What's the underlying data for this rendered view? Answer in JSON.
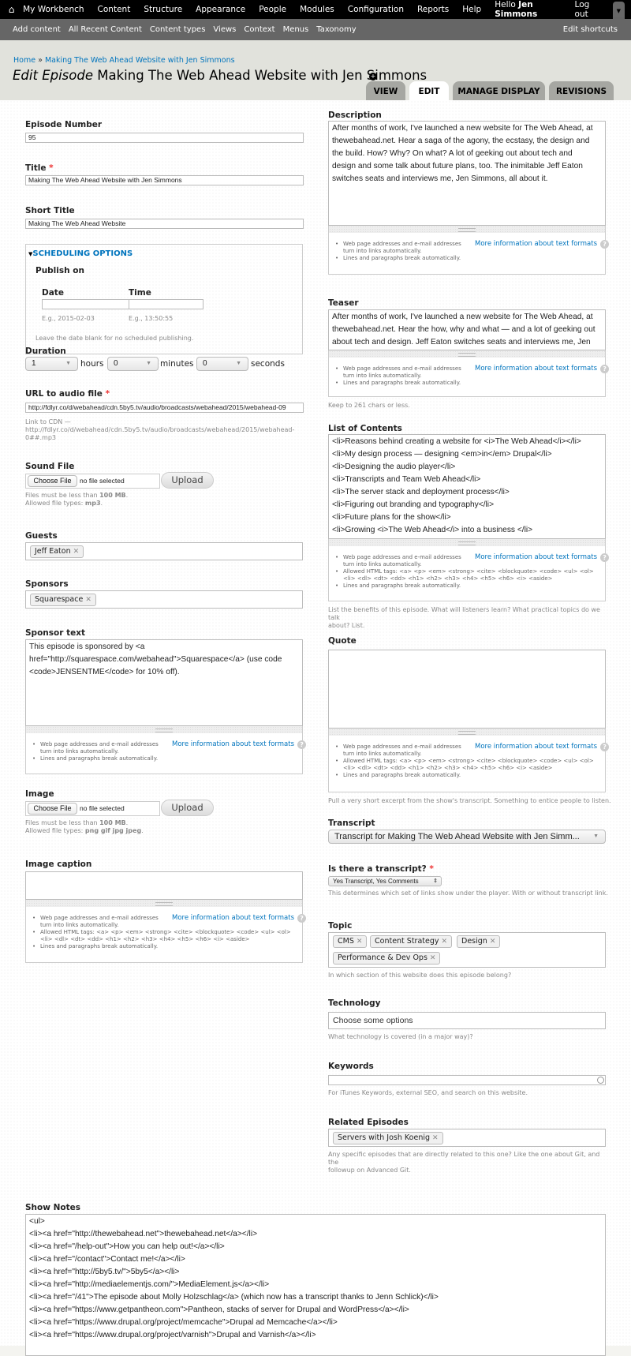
{
  "toolbar": {
    "home_icon": "home-icon",
    "menu": [
      "My Workbench",
      "Content",
      "Structure",
      "Appearance",
      "People",
      "Modules",
      "Configuration",
      "Reports",
      "Help"
    ],
    "hello_prefix": "Hello ",
    "user_name": "Jen Simmons",
    "logout": "Log out",
    "drawer_icon": "chevron-down-icon",
    "shortcuts": [
      "Add content",
      "All Recent Content",
      "Content types",
      "Views",
      "Context",
      "Menus",
      "Taxonomy"
    ],
    "edit_shortcuts": "Edit shortcuts"
  },
  "header": {
    "breadcrumb": {
      "home": "Home",
      "separator": "»",
      "current": "Making The Web Ahead Website with Jen Simmons"
    },
    "title_prefix": "Edit Episode",
    "title": "Making The Web Ahead Website with Jen Simmons",
    "add_shortcut_icon": "plus-circle-icon",
    "tabs": [
      {
        "label": "VIEW",
        "active": false
      },
      {
        "label": "EDIT",
        "active": true
      },
      {
        "label": "MANAGE DISPLAY",
        "active": false
      },
      {
        "label": "REVISIONS",
        "active": false
      }
    ]
  },
  "colors": {
    "link": "#0074bd",
    "required": "#e33333",
    "toolbar": "#000000",
    "shortcuts": "#666666"
  },
  "filter_tips": {
    "urls": "Web page addresses and e-mail addresses turn into links automatically.",
    "allowed_html": "Allowed HTML tags: <a> <p> <em> <strong> <cite> <blockquote> <code> <ul> <ol> <li> <dl> <dt> <dd> <h1> <h2> <h3> <h4> <h5> <h6> <i> <aside>",
    "linebreaks": "Lines and paragraphs break automatically.",
    "more_info": "More information about text formats",
    "help_icon": "question-icon"
  },
  "left": {
    "episode_number": {
      "label": "Episode Number",
      "value": "95"
    },
    "title": {
      "label": "Title",
      "required": "*",
      "value": "Making The Web Ahead Website with Jen Simmons"
    },
    "short_title": {
      "label": "Short Title",
      "value": "Making The Web Ahead Website"
    },
    "scheduling": {
      "legend": "SCHEDULING OPTIONS",
      "collapse_icon": "triangle-down-icon",
      "publish_on": "Publish on",
      "date_label": "Date",
      "time_label": "Time",
      "date_value": "",
      "time_value": "",
      "date_example": "E.g., 2015-02-03",
      "time_example": "E.g., 13:50:55",
      "description": "Leave the date blank for no scheduled publishing."
    },
    "duration": {
      "label": "Duration",
      "hours": "1",
      "hours_unit": "hours",
      "minutes": "0",
      "minutes_unit": "minutes",
      "seconds": "0",
      "seconds_unit": "seconds"
    },
    "audio_url": {
      "label": "URL to audio file",
      "required": "*",
      "value": "http://fdlyr.co/d/webahead/cdn.5by5.tv/audio/broadcasts/webahead/2015/webahead-09",
      "description_line1": "Link to CDN —",
      "description_line2": "http://fdlyr.co/d/webahead/cdn.5by5.tv/audio/broadcasts/webahead/2015/webahead-",
      "description_line3": "0##.mp3"
    },
    "sound_file": {
      "label": "Sound File",
      "choose": "Choose File",
      "none": "no file selected",
      "upload": "Upload",
      "limit_prefix": "Files must be less than ",
      "limit": "100 MB",
      "limit_suffix": ".",
      "types_prefix": "Allowed file types: ",
      "types": "mp3",
      "types_suffix": "."
    },
    "guests": {
      "label": "Guests",
      "tags": [
        "Jeff Eaton"
      ]
    },
    "sponsors": {
      "label": "Sponsors",
      "tags": [
        "Squarespace"
      ]
    },
    "sponsor_text": {
      "label": "Sponsor text",
      "lines": [
        "This episode is sponsored by <a",
        "href=\"http://squarespace.com/webahead\">Squarespace</a> (use code",
        "<code>JENSENTME</code> for 10% off)."
      ]
    },
    "image": {
      "label": "Image",
      "choose": "Choose File",
      "none": "no file selected",
      "upload": "Upload",
      "limit_prefix": "Files must be less than ",
      "limit": "100 MB",
      "limit_suffix": ".",
      "types_prefix": "Allowed file types: ",
      "types": "png gif jpg jpeg",
      "types_suffix": "."
    },
    "image_caption": {
      "label": "Image caption",
      "value": ""
    }
  },
  "right": {
    "description": {
      "label": "Description",
      "lines": [
        "After months of work, I've launched a new website for The Web Ahead, at",
        "thewebahead.net. Hear a saga of the agony, the ecstasy, the design and",
        "the build. How? Why? On what? A lot of geeking out about tech and",
        "design and some talk about future plans, too. The inimitable Jeff Eaton",
        "switches seats and interviews me, Jen Simmons, all about it."
      ]
    },
    "teaser": {
      "label": "Teaser",
      "lines": [
        "After months of work, I've launched a new website for The Web Ahead, at",
        "thewebahead.net. Hear the how, why and what — and a lot of geeking out",
        "about tech and design. Jeff Eaton switches seats and interviews me, Jen"
      ],
      "description": "Keep to 261 chars or less."
    },
    "contents": {
      "label": "List of Contents",
      "lines": [
        "<li>Reasons behind creating a website for <i>The Web Ahead</i></li>",
        "<li>My design process — designing <em>in</em> Drupal</li>",
        "<li>Designing the audio player</li>",
        "<li>Transcripts and Team Web Ahead</li>",
        "<li>The server stack and deployment process</li>",
        "<li>Figuring out branding and typography</li>",
        "<li>Future plans for the show</li>",
        "<li>Growing <i>The Web Ahead</i> into a business </li>"
      ],
      "description_line1": "List the benefits of this episode. What will listeners learn? What practical topics do we talk",
      "description_line2": "about? List."
    },
    "quote": {
      "label": "Quote",
      "value": "",
      "description": "Pull a very short excerpt from the show's transcript. Something to entice people to listen."
    },
    "transcript": {
      "label": "Transcript",
      "value": "Transcript for Making The Web Ahead Website with Jen Simm..."
    },
    "has_transcript": {
      "label": "Is there a transcript?",
      "required": "*",
      "value": "Yes Transcript, Yes Comments",
      "description": "This determines which set of links show under the player. With or without transcript link."
    },
    "topic": {
      "label": "Topic",
      "tags": [
        "CMS",
        "Content Strategy",
        "Design",
        "Performance & Dev Ops"
      ],
      "description": "In which section of this website does this episode belong?"
    },
    "technology": {
      "label": "Technology",
      "placeholder": "Choose some options",
      "description": "What technology is covered (in a major way)?"
    },
    "keywords": {
      "label": "Keywords",
      "value": "",
      "description": "For iTunes Keywords, external SEO, and search on this website."
    },
    "related": {
      "label": "Related Episodes",
      "tags": [
        "Servers with Josh Koenig"
      ],
      "description_line1": "Any specific episodes that are directly related to this one? Like the one about Git, and the",
      "description_line2": "followup on Advanced Git."
    }
  },
  "show_notes": {
    "label": "Show Notes",
    "lines": [
      "<ul>",
      "<li><a href=\"http://thewebahead.net\">thewebahead.net</a></li>",
      "<li><a href=\"/help-out\">How you can help out!</a></li>",
      "<li><a href=\"/contact\">Contact me!</a></li>",
      "<li><a href=\"http://5by5.tv/\">5by5</a></li>",
      "<li><a href=\"http://mediaelementjs.com/\">MediaElement.js</a></li>",
      "<li><a href=\"/41\">The episode about Molly Holzschlag</a> (which now has a transcript thanks to Jenn Schlick)</li>",
      "<li><a href=\"https://www.getpantheon.com\">Pantheon, stacks of server for Drupal and WordPress</a></li>",
      "<li><a href=\"https://www.drupal.org/project/memcache\">Drupal ad Memcache</a></li>",
      "<li><a href=\"https://www.drupal.org/project/varnish\">Drupal and Varnish</a></li>"
    ]
  }
}
